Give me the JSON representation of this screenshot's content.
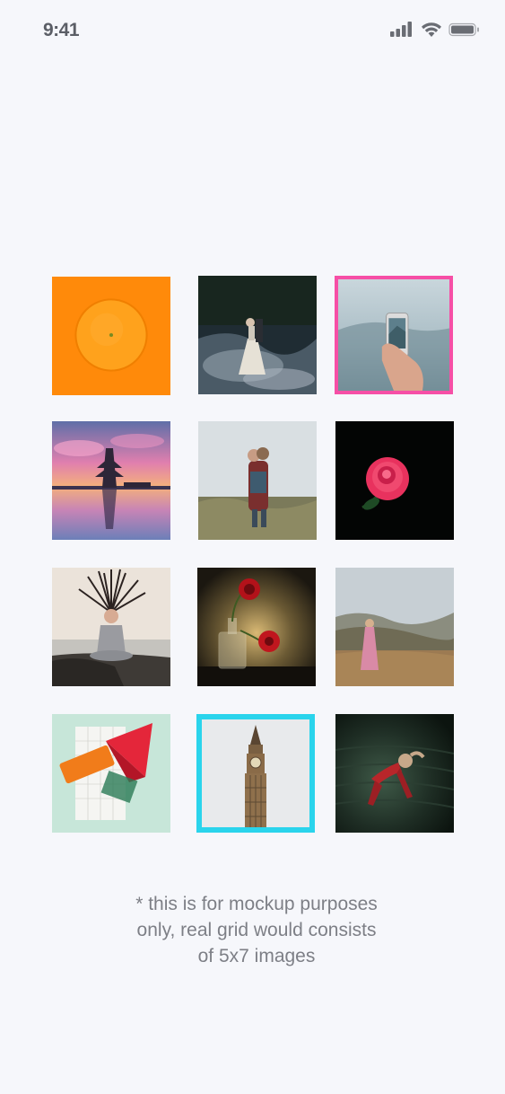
{
  "status_bar": {
    "time": "9:41",
    "icons": [
      "signal-icon",
      "wifi-icon",
      "battery-icon"
    ]
  },
  "grid": {
    "tiles": [
      {
        "name": "orange",
        "selected": false
      },
      {
        "name": "dancing-couple-in-mist",
        "selected": false
      },
      {
        "name": "hand-holding-phone",
        "selected": true,
        "highlight": "#f64fa6"
      },
      {
        "name": "temple-at-sunset",
        "selected": false
      },
      {
        "name": "couple-in-field",
        "selected": false
      },
      {
        "name": "red-rose",
        "selected": false
      },
      {
        "name": "woman-with-flying-hair",
        "selected": false
      },
      {
        "name": "red-flowers-in-bottle",
        "selected": false
      },
      {
        "name": "woman-in-pink-dress-landscape",
        "selected": false
      },
      {
        "name": "geometric-shapes",
        "selected": false
      },
      {
        "name": "big-ben",
        "selected": true,
        "highlight": "#2ad4ec"
      },
      {
        "name": "dancer-in-dark",
        "selected": false
      }
    ]
  },
  "footnote": {
    "text": "* this is for mockup purposes only, real grid would consists of 5x7 images"
  },
  "colors": {
    "background": "#f6f7fb",
    "pink_highlight": "#f64fa6",
    "cyan_highlight": "#2ad4ec",
    "status_text": "#5b5e66",
    "footnote_text": "#7d7f86"
  }
}
